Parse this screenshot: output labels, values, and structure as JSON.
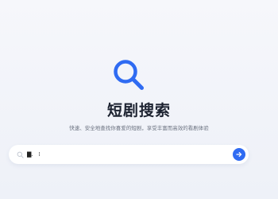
{
  "hero": {
    "icon": "search-icon",
    "title": "短剧搜索",
    "subtitle": "快速、安全地查找你喜爱的短剧，享受丰富而高效的看剧体验"
  },
  "search": {
    "value": "▇.   ⁞",
    "placeholder": "",
    "leading_icon": "search-icon",
    "submit_icon": "arrow-right-icon"
  },
  "colors": {
    "accent": "#2f6bf2",
    "title": "#1c2230",
    "subtitle": "#6b7280",
    "background": "#f3f5fa"
  }
}
